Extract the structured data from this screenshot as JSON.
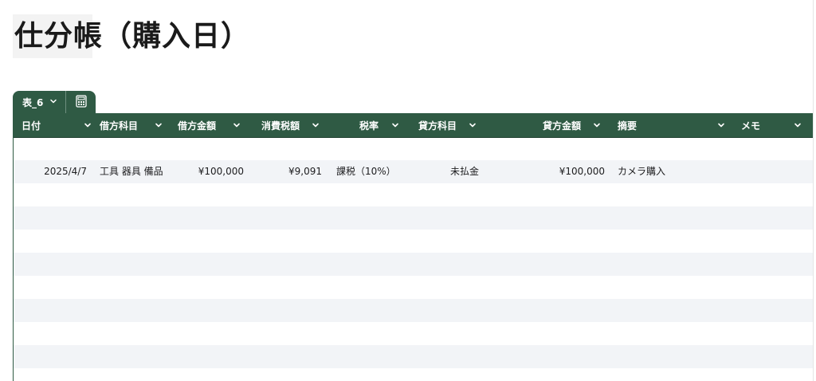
{
  "page": {
    "title": "仕分帳（購入日）"
  },
  "table_tab": {
    "name": "表_6"
  },
  "columns": [
    {
      "label": "日付"
    },
    {
      "label": "借方科目"
    },
    {
      "label": "借方金額"
    },
    {
      "label": "消費税額"
    },
    {
      "label": "税率"
    },
    {
      "label": "貸方科目"
    },
    {
      "label": "貸方金額"
    },
    {
      "label": "摘要"
    },
    {
      "label": "メモ"
    }
  ],
  "rows": [
    {
      "date": "",
      "debit_account": "",
      "debit_amount": "",
      "tax_amount": "",
      "tax_rate": "",
      "credit_account": "",
      "credit_amount": "",
      "summary": "",
      "memo": ""
    },
    {
      "date": "2025/4/7",
      "debit_account": "工具 器具 備品",
      "debit_amount": "¥100,000",
      "tax_amount": "¥9,091",
      "tax_rate": "課税（10%）",
      "credit_account": "未払金",
      "credit_amount": "¥100,000",
      "summary": "カメラ購入",
      "memo": ""
    },
    {
      "date": "",
      "debit_account": "",
      "debit_amount": "",
      "tax_amount": "",
      "tax_rate": "",
      "credit_account": "",
      "credit_amount": "",
      "summary": "",
      "memo": ""
    },
    {
      "date": "",
      "debit_account": "",
      "debit_amount": "",
      "tax_amount": "",
      "tax_rate": "",
      "credit_account": "",
      "credit_amount": "",
      "summary": "",
      "memo": ""
    },
    {
      "date": "",
      "debit_account": "",
      "debit_amount": "",
      "tax_amount": "",
      "tax_rate": "",
      "credit_account": "",
      "credit_amount": "",
      "summary": "",
      "memo": ""
    },
    {
      "date": "",
      "debit_account": "",
      "debit_amount": "",
      "tax_amount": "",
      "tax_rate": "",
      "credit_account": "",
      "credit_amount": "",
      "summary": "",
      "memo": ""
    },
    {
      "date": "",
      "debit_account": "",
      "debit_amount": "",
      "tax_amount": "",
      "tax_rate": "",
      "credit_account": "",
      "credit_amount": "",
      "summary": "",
      "memo": ""
    },
    {
      "date": "",
      "debit_account": "",
      "debit_amount": "",
      "tax_amount": "",
      "tax_rate": "",
      "credit_account": "",
      "credit_amount": "",
      "summary": "",
      "memo": ""
    },
    {
      "date": "",
      "debit_account": "",
      "debit_amount": "",
      "tax_amount": "",
      "tax_rate": "",
      "credit_account": "",
      "credit_amount": "",
      "summary": "",
      "memo": ""
    },
    {
      "date": "",
      "debit_account": "",
      "debit_amount": "",
      "tax_amount": "",
      "tax_rate": "",
      "credit_account": "",
      "credit_amount": "",
      "summary": "",
      "memo": ""
    },
    {
      "date": "",
      "debit_account": "",
      "debit_amount": "",
      "tax_amount": "",
      "tax_rate": "",
      "credit_account": "",
      "credit_amount": "",
      "summary": "",
      "memo": ""
    }
  ],
  "colors": {
    "header_bg": "#2f5a44",
    "stripe": "#f2f4f7"
  },
  "icons": {
    "tab_menu": "chevron-down-icon",
    "calc": "calculator-icon",
    "column_menu": "chevron-down-icon"
  }
}
